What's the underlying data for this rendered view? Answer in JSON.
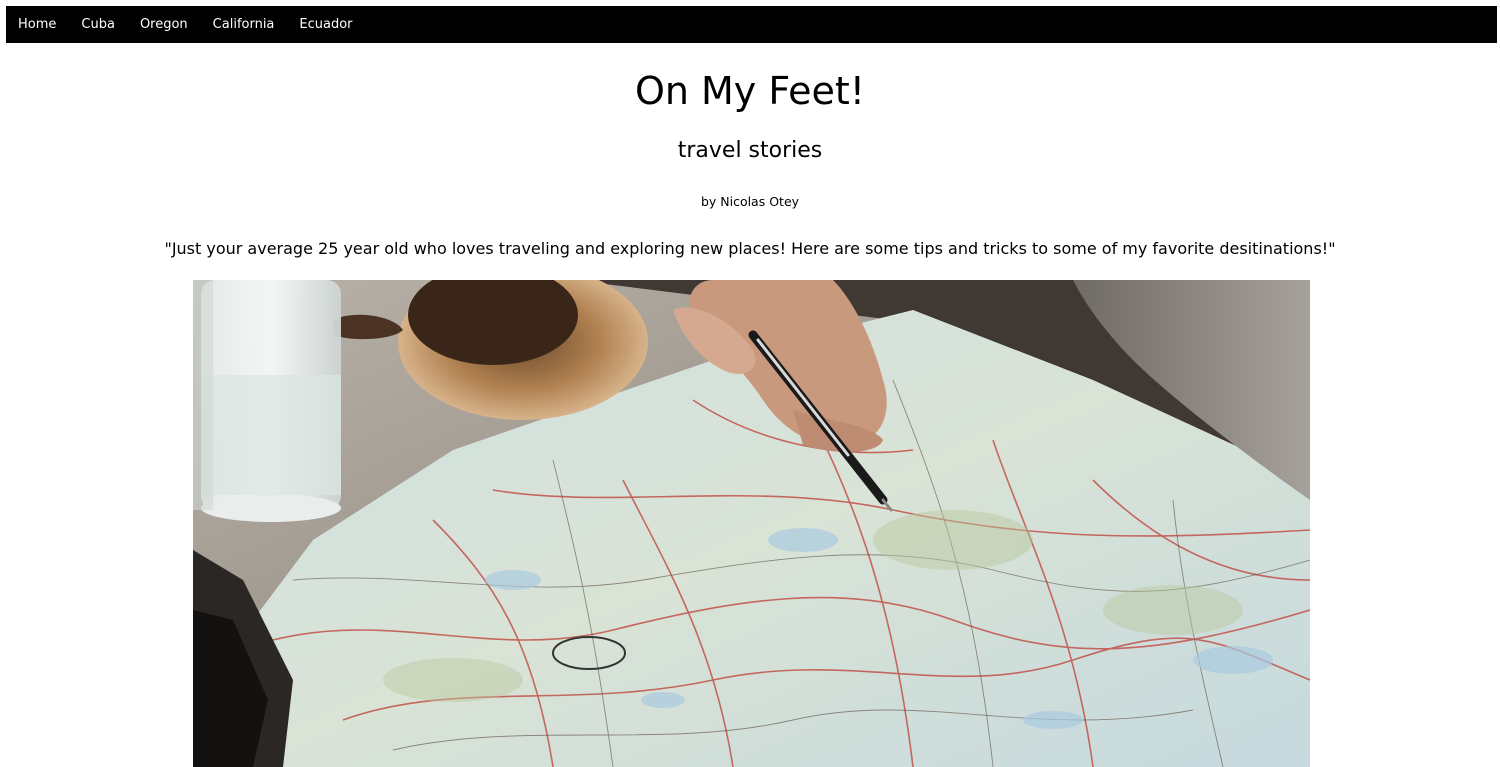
{
  "nav": {
    "items": [
      {
        "label": "Home"
      },
      {
        "label": "Cuba"
      },
      {
        "label": "Oregon"
      },
      {
        "label": "California"
      },
      {
        "label": "Ecuador"
      }
    ]
  },
  "header": {
    "title": "On My Feet!",
    "subtitle": "travel stories",
    "byline": "by Nicolas Otey"
  },
  "intro": {
    "tagline": "\"Just your average 25 year old who loves traveling and exploring new places! Here are some tips and tricks to some of my favorite desitinations!\""
  },
  "hero_image": {
    "description": "map-with-hand-and-pen-photo"
  },
  "colors": {
    "navbar_bg": "#000000",
    "nav_text": "#ffffff",
    "page_bg": "#ffffff"
  }
}
